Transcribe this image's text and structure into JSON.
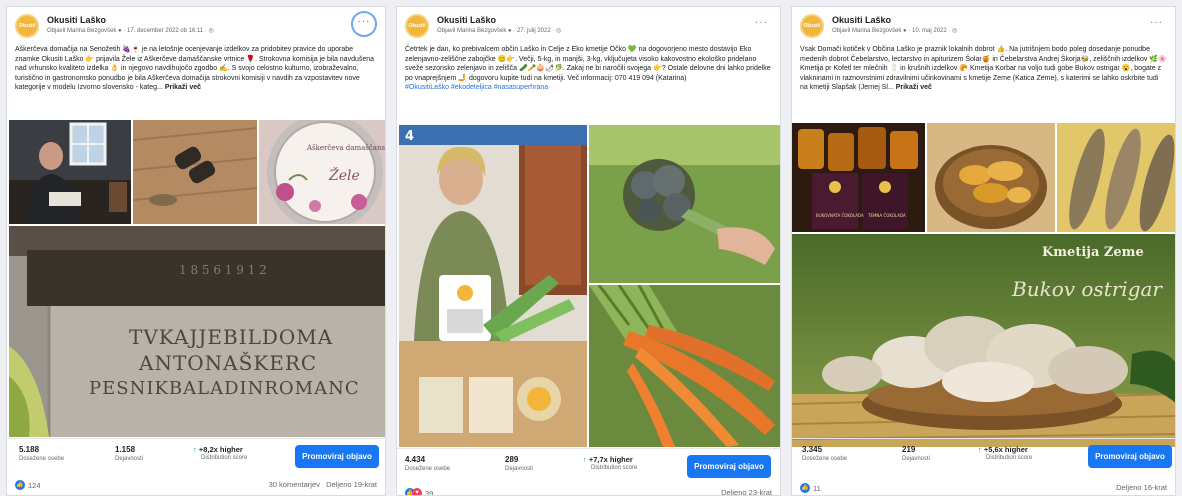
{
  "posts": [
    {
      "page_name": "Okusiti Laško",
      "byline": "Objavil Marina Bezgovšek ● · 17. december 2022 ob 16:11 · ◎",
      "text": "Aškerčeva domačija na Senožetih 🍇🍷 je na letošnje ocenjevanje izdelkov za pridobitev pravice do uporabe znamke Okusiti Laško 👉 prijavila Žele iz Aškerčeve damaščanske vrtnice 🌹. Strokovna komisija je bila navdušena nad vrhunsko kvaliteto izdelka 👌 in njegovo navdihujočo zgodbo ✍. S svojo celostno kulturno, izobraževalno, turistično in gastronomsko ponudbo je bila Aškerčeva domačija strokovni komisiji v navdih za vzpostavitev nove kategorije v modelu Izvorno slovensko - kateg...",
      "more_link": "Prikaži več",
      "images": {
        "stone_line1": "TVKAJJEBILDOMA",
        "stone_line2": "ANTONAŠKERC",
        "stone_line3": "PESNIKBALADINROMANC",
        "stone_year": "1 8 5 6   1 9 1 2",
        "jar_label": "Aškerčeva damaščanska vrtnica",
        "jar_sub": "Žele"
      },
      "stats": {
        "reach": "5.188",
        "reach_label": "Dosežene osebe",
        "engagement": "1.158",
        "engagement_label": "Dejavnosti",
        "distribution": "+8,2x higher",
        "distribution_label": "Distribution score"
      },
      "promote_label": "Promoviraj objavo",
      "reactions": "124",
      "comments": "30 komentarjev",
      "shares": "Deljeno 19-krat"
    },
    {
      "page_name": "Okusiti Laško",
      "byline": "Objavil Marina Bezgovšek ● · 27. julij 2022 · ◎",
      "text": "Četrtek je dan, ko prebivalcem občin Laško in Celje z Eko kmetije Očko 💚 na dogovorjeno mesto dostavijo Eko zelenjavno-zeliščne zabojčke 😊👉. Večji, 5-kg, in manjši, 3-kg, vključujeta visoko kakovostno ekološko pridelano sveže sezonsko zelenjavo in zelišča 🥒🥕🧅🌶🥬. Zakaj ne bi naročili svojega 👉? Ostale delovne dni lahko pridelke po vnaprejšnjem 🤳 dogovoru kupite tudi na kmetiji. Več informacij: 070 419 094 (Katarina)",
      "hashtags": "#OkusitiLaško #ekodeteljica #nasasuperhrana",
      "images": {
        "box_number": "4"
      },
      "stats": {
        "reach": "4.434",
        "reach_label": "Dosežene osebe",
        "engagement": "289",
        "engagement_label": "Dejavnosti",
        "distribution": "+7,7x higher",
        "distribution_label": "Distribution score"
      },
      "promote_label": "Promoviraj objavo",
      "reactions": "39",
      "shares": "Deljeno 23-krat"
    },
    {
      "page_name": "Okusiti Laško",
      "byline": "Objavil Marina Bezgovšek ● · 10. maj 2022 · ◎",
      "text": "Vsak Domači kotiček v Občina Laško je praznik lokalnih dobrot 👍. Na jutrišnjem bodo poleg dosedanje ponudbe medenih dobrot Čebelarstvo, lectarstvo in apiturizem Šolar🍯 in Čebelarstva Andrej Škorja🐝, zeliščnih izdelkov 🌿🌸 Kmetija pr Kofetl ter mlečnih 🥛 in krušnih izdelkov 🥐 Kmetija Korbar na voljo tudi gobe Bukov ostrigar 😮, bogate z vlakninami in raznovrstnimi zdravilnimi učinkovinami s kmetije Zeme (Katica Zeme), s katerimi se lahko oskrbite tudi na kmetiji Slapšak (Jernej Sl...",
      "more_link": "Prikaži več",
      "images": {
        "banner_title": "Kmetija Zeme",
        "banner_script": "Bukov ostrigar",
        "choc1": "BUKOVNATA ČOKOLADA",
        "choc2": "TEMNA ČOKOLADA"
      },
      "stats": {
        "reach": "3.345",
        "reach_label": "Dosežene osebe",
        "engagement": "219",
        "engagement_label": "Dejavnosti",
        "distribution": "+5,6x higher",
        "distribution_label": "Distribution score"
      },
      "promote_label": "Promoviraj objavo",
      "reactions": "11",
      "shares": "Deljeno 16-krat"
    }
  ],
  "avatar_text": "Okusiti",
  "colors": {
    "accent": "#1877f2",
    "up_arrow": "#23a55a",
    "link": "#2670d9"
  }
}
